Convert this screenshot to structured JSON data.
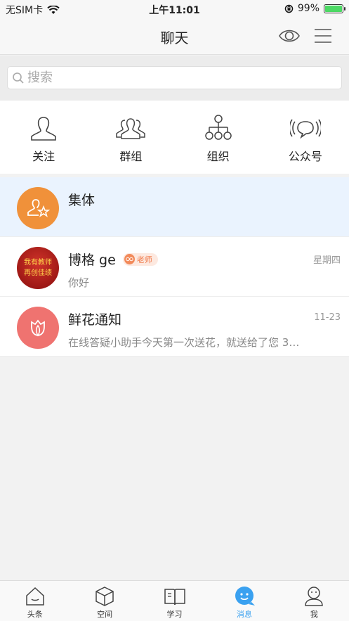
{
  "status": {
    "carrier": "无SIM卡",
    "time": "上午11:01",
    "battery": "99%",
    "battery_level": 0.99
  },
  "nav": {
    "title": "聊天"
  },
  "search": {
    "placeholder": "搜索"
  },
  "quick": [
    {
      "label": "关注",
      "icon": "person-icon"
    },
    {
      "label": "群组",
      "icon": "group-icon"
    },
    {
      "label": "组织",
      "icon": "org-chart-icon"
    },
    {
      "label": "公众号",
      "icon": "broadcast-icon"
    }
  ],
  "chats": [
    {
      "name": "集体",
      "time": "",
      "preview": ""
    },
    {
      "name": "博格 ge",
      "badge": "老师",
      "time": "星期四",
      "preview": "你好",
      "avatar_text": "我有教师 再创佳绩"
    },
    {
      "name": "鲜花通知",
      "time": "11-23",
      "preview": "在线答疑小助手今天第一次送花，就送给了您 3…"
    }
  ],
  "tabs": [
    {
      "label": "头条",
      "icon": "home-icon"
    },
    {
      "label": "空间",
      "icon": "cube-icon"
    },
    {
      "label": "学习",
      "icon": "book-icon"
    },
    {
      "label": "消息",
      "icon": "message-icon",
      "active": true
    },
    {
      "label": "我",
      "icon": "profile-icon"
    }
  ],
  "colors": {
    "accent": "#3aa1f0",
    "group_avatar": "#f0913a",
    "flower_avatar": "#ef7370",
    "teacher_avatar": "#b01818"
  }
}
